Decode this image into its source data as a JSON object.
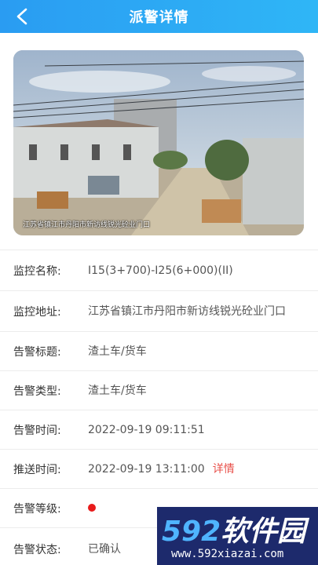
{
  "header": {
    "title": "派警详情"
  },
  "snapshot": {
    "caption": "江苏省镇江市丹阳市新访线锐光砼业门口"
  },
  "details": {
    "monitor_name": {
      "label": "监控名称:",
      "value": "I15(3+700)-I25(6+000)(II)"
    },
    "monitor_address": {
      "label": "监控地址:",
      "value": "江苏省镇江市丹阳市新访线锐光砼业门口"
    },
    "alarm_title": {
      "label": "告警标题:",
      "value": "渣土车/货车"
    },
    "alarm_type": {
      "label": "告警类型:",
      "value": "渣土车/货车"
    },
    "alarm_time": {
      "label": "告警时间:",
      "value": "2022-09-19 09:11:51"
    },
    "push_time": {
      "label": "推送时间:",
      "value": "2022-09-19 13:11:00",
      "link": "详情"
    },
    "alarm_level": {
      "label": "告警等级:",
      "color": "#e81b1b"
    },
    "alarm_status": {
      "label": "告警状态:",
      "value": "已确认"
    }
  },
  "watermark": {
    "brand_num": "592",
    "brand_text": "软件园",
    "url": "www.592xiazai.com"
  },
  "colors": {
    "header": "#2a9cf2",
    "link": "#e8504a",
    "status_ok": "#2fb84a",
    "watermark_bg": "#1d2a6c"
  }
}
